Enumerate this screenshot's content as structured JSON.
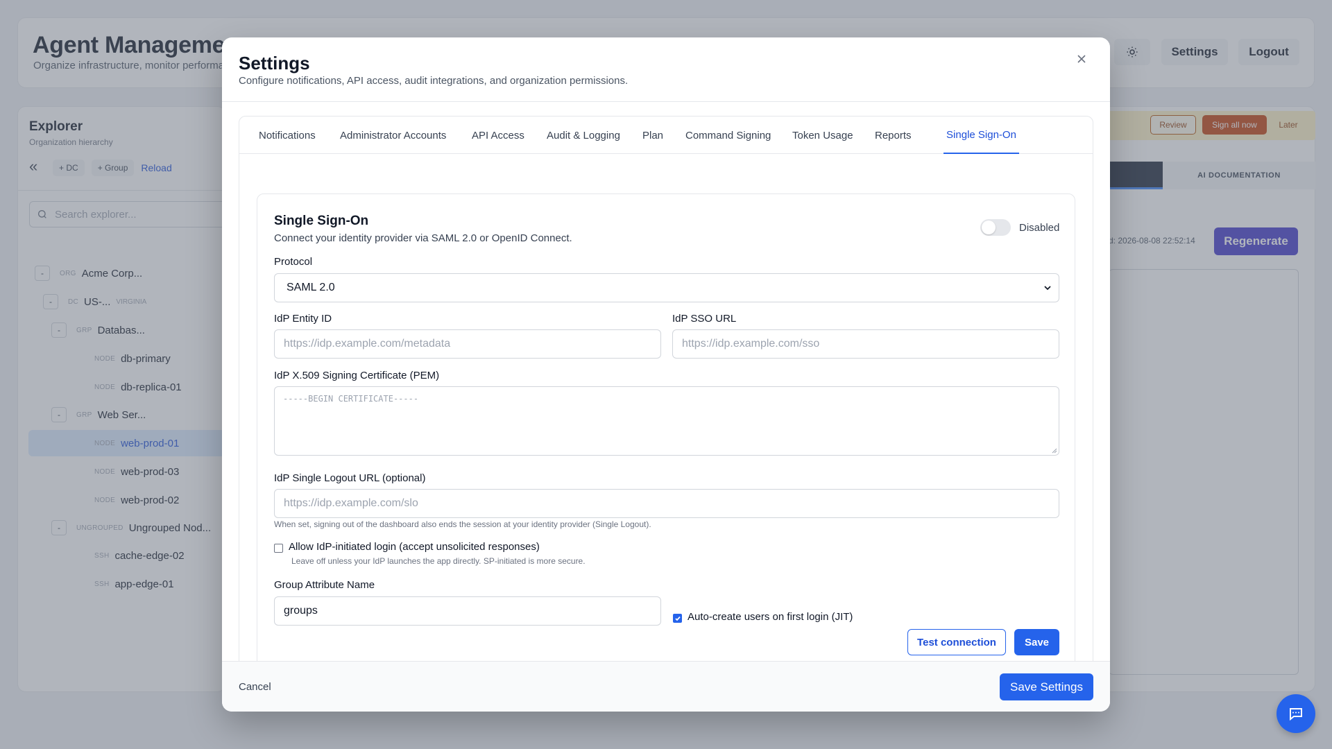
{
  "app": {
    "title": "Agent Managemen",
    "subtitle": "Organize infrastructure, monitor performa",
    "header_buttons": {
      "settings": "Settings",
      "logout": "Logout"
    }
  },
  "explorer": {
    "title": "Explorer",
    "subtitle": "Organization hierarchy",
    "toolbar": {
      "add_dc": "+ DC",
      "add_group": "+ Group",
      "reload": "Reload"
    },
    "search_placeholder": "Search explorer...",
    "tree": [
      {
        "toggle": "-",
        "kind": "ORG",
        "name": "Acme Corp...",
        "meta": ""
      },
      {
        "toggle": "-",
        "kind": "DC",
        "name": "US-...",
        "meta": "VIRGINIA"
      },
      {
        "toggle": "-",
        "kind": "GRP",
        "name": "Databas...",
        "meta": ""
      },
      {
        "toggle": "",
        "kind": "NODE",
        "name": "db-primary",
        "meta": ""
      },
      {
        "toggle": "",
        "kind": "NODE",
        "name": "db-replica-01",
        "meta": ""
      },
      {
        "toggle": "-",
        "kind": "GRP",
        "name": "Web Ser...",
        "meta": ""
      },
      {
        "toggle": "",
        "kind": "NODE",
        "name": "web-prod-01",
        "meta": ""
      },
      {
        "toggle": "",
        "kind": "NODE",
        "name": "web-prod-03",
        "meta": ""
      },
      {
        "toggle": "",
        "kind": "NODE",
        "name": "web-prod-02",
        "meta": ""
      },
      {
        "toggle": "-",
        "kind": "UNGROUPED",
        "name": "Ungrouped Nod...",
        "meta": ""
      },
      {
        "toggle": "",
        "kind": "SSH",
        "name": "cache-edge-02",
        "meta": ""
      },
      {
        "toggle": "",
        "kind": "SSH",
        "name": "app-edge-01",
        "meta": ""
      }
    ]
  },
  "right_panel": {
    "banner": {
      "review": "Review",
      "sign_all": "Sign all now",
      "later": "Later"
    },
    "ai_doc_tab": "AI DOCUMENTATION",
    "generated": "d: 2026-08-08 22:52:14",
    "regenerate": "Regenerate"
  },
  "modal": {
    "title": "Settings",
    "subtitle": "Configure notifications, API access, audit integrations, and organization permissions.",
    "tabs": [
      "Notifications",
      "Administrator Accounts",
      "API Access",
      "Audit & Logging",
      "Plan",
      "Command Signing",
      "Token Usage",
      "Reports",
      "Single Sign-On"
    ],
    "active_tab": "Single Sign-On",
    "sso": {
      "title": "Single Sign-On",
      "description": "Connect your identity provider via SAML 2.0 or OpenID Connect.",
      "toggle_label": "Disabled",
      "enabled": false,
      "protocol_label": "Protocol",
      "protocol_value": "SAML 2.0",
      "entity_id_label": "IdP Entity ID",
      "entity_id_placeholder": "https://idp.example.com/metadata",
      "sso_url_label": "IdP SSO URL",
      "sso_url_placeholder": "https://idp.example.com/sso",
      "cert_label": "IdP X.509 Signing Certificate (PEM)",
      "cert_placeholder": "-----BEGIN CERTIFICATE-----",
      "logout_label": "IdP Single Logout URL (optional)",
      "logout_placeholder": "https://idp.example.com/slo",
      "logout_hint": "When set, signing out of the dashboard also ends the session at your identity provider (Single Logout).",
      "idp_initiated_label": "Allow IdP-initiated login (accept unsolicited responses)",
      "idp_initiated_hint": "Leave off unless your IdP launches the app directly. SP-initiated is more secure.",
      "idp_initiated_checked": false,
      "group_attr_label": "Group Attribute Name",
      "group_attr_value": "groups",
      "jit_label": "Auto-create users on first login (JIT)",
      "jit_checked": true,
      "test_connection": "Test connection",
      "save": "Save"
    },
    "footer": {
      "cancel": "Cancel",
      "save_settings": "Save Settings"
    }
  },
  "colors": {
    "accent": "#2563eb",
    "regenerate": "#4338ca",
    "sign_all": "#c2410c"
  }
}
